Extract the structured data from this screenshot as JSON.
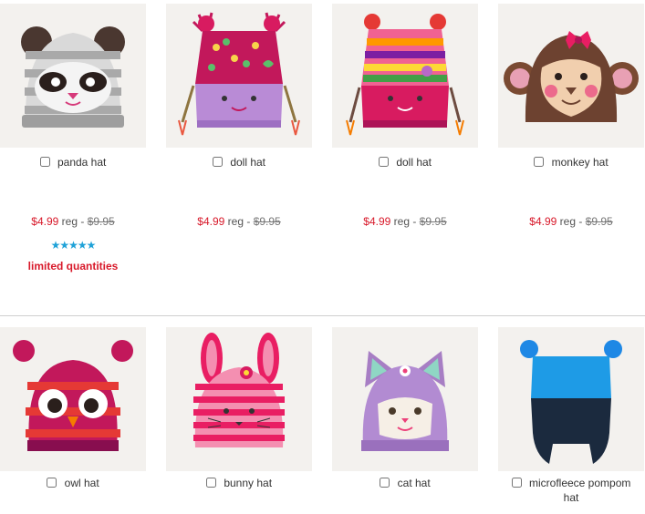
{
  "products_row1": [
    {
      "name": "panda hat",
      "sale_price": "$4.99",
      "reg_label": "reg -",
      "reg_price": "$9.95",
      "rating_stars": "★★★★★",
      "rating_value": 5,
      "rating_max": 5,
      "stock_note": "limited quantities"
    },
    {
      "name": "doll hat",
      "sale_price": "$4.99",
      "reg_label": "reg -",
      "reg_price": "$9.95"
    },
    {
      "name": "doll hat",
      "sale_price": "$4.99",
      "reg_label": "reg -",
      "reg_price": "$9.95"
    },
    {
      "name": "monkey hat",
      "sale_price": "$4.99",
      "reg_label": "reg -",
      "reg_price": "$9.95"
    }
  ],
  "products_row2": [
    {
      "name": "owl hat"
    },
    {
      "name": "bunny hat"
    },
    {
      "name": "cat hat"
    },
    {
      "name_line1": "microfleece pompom",
      "name_line2": "hat"
    }
  ],
  "colors": {
    "sale_price": "#d8192a",
    "star": "#1fa2d8",
    "thumb_bg": "#f3f1ee",
    "divider": "#cfcfcf"
  }
}
